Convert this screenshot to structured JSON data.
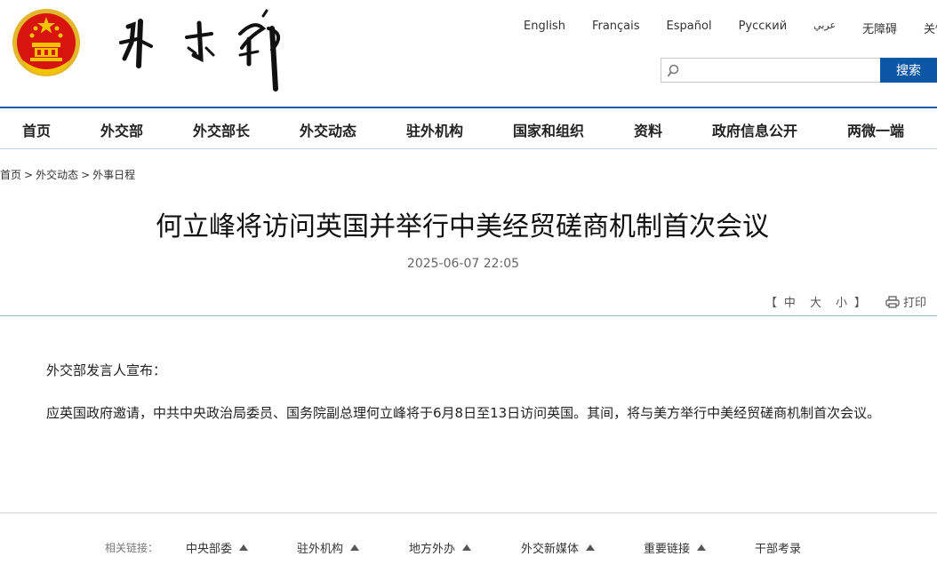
{
  "header": {
    "languages": [
      "English",
      "Français",
      "Español",
      "Русский",
      "عربي",
      "无障碍",
      "关怀版"
    ],
    "search_placeholder": "",
    "search_button": "搜索"
  },
  "nav": {
    "items": [
      "首页",
      "外交部",
      "外交部长",
      "外交动态",
      "驻外机构",
      "国家和组织",
      "资料",
      "政府信息公开",
      "两微一端"
    ]
  },
  "breadcrumb": [
    "首页",
    "外交动态",
    "外事日程"
  ],
  "breadcrumb_separator": ">",
  "article": {
    "title": "何立峰将访问英国并举行中美经贸磋商机制首次会议",
    "date": "2025-06-07 22:05",
    "paragraphs": [
      "外交部发言人宣布：",
      "应英国政府邀请，中共中央政治局委员、国务院副总理何立峰将于6月8日至13日访问英国。其间，将与美方举行中美经贸磋商机制首次会议。"
    ]
  },
  "tools": {
    "bracket_open": "【",
    "sizes": [
      "中",
      "大",
      "小"
    ],
    "bracket_close": "】",
    "print_label": "打印"
  },
  "footer": {
    "label": "相关链接：",
    "links": [
      "中央部委",
      "驻外机构",
      "地方外办",
      "外交新媒体",
      "重要链接",
      "干部考录"
    ]
  },
  "colors": {
    "accent_blue": "#0b56a5",
    "emblem_red": "#d8140f",
    "emblem_gold": "#f2c400"
  }
}
